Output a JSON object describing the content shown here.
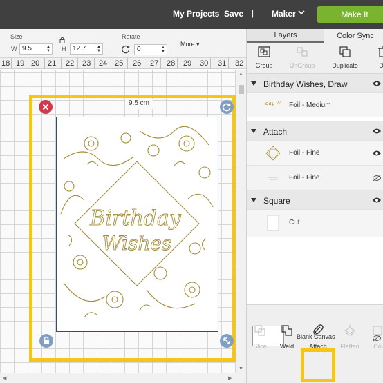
{
  "header": {
    "my_projects": "My Projects",
    "save": "Save",
    "separator": "|",
    "machine": "Maker",
    "make_it": "Make It",
    "make_it_color": "#7ab42e"
  },
  "toolbar": {
    "size_label": "Size",
    "w_label": "W",
    "w_value": "9.5",
    "h_label": "H",
    "h_value": "12.7",
    "rotate_label": "Rotate",
    "rotate_value": "0",
    "more_label": "More"
  },
  "ruler": {
    "ticks": [
      "18",
      "19",
      "20",
      "21",
      "22",
      "23",
      "24",
      "25",
      "26",
      "27",
      "28",
      "29",
      "30",
      "31",
      "32"
    ]
  },
  "canvas": {
    "width_label": "9.5 cm",
    "design_text_line1": "Birthday",
    "design_text_line2": "Wishes",
    "design_color": "#a58d36",
    "highlight_color": "#f5c518"
  },
  "panel": {
    "tabs": [
      "Layers",
      "Color Sync"
    ],
    "tools": [
      {
        "label": "Group",
        "enabled": true,
        "icon": "group-icon"
      },
      {
        "label": "UnGroup",
        "enabled": false,
        "icon": "ungroup-icon"
      },
      {
        "label": "Duplicate",
        "enabled": true,
        "icon": "duplicate-icon"
      },
      {
        "label": "De",
        "enabled": true,
        "icon": "delete-icon"
      }
    ],
    "groups": [
      {
        "name": "Birthday Wishes, Draw",
        "items": [
          {
            "label": "Foil - Medium",
            "thumb": "Birthday Wishes"
          }
        ]
      },
      {
        "name": "Attach",
        "items": [
          {
            "label": "Foil - Fine"
          },
          {
            "label": "Foil - Fine"
          }
        ]
      },
      {
        "name": "Square",
        "items": [
          {
            "label": "Cut"
          }
        ]
      }
    ],
    "blank_canvas": "Blank Canvas",
    "bottom_tools": [
      {
        "label": "Slice",
        "enabled": false,
        "icon": "slice-icon"
      },
      {
        "label": "Weld",
        "enabled": true,
        "icon": "weld-icon"
      },
      {
        "label": "Attach",
        "enabled": true,
        "icon": "attach-icon"
      },
      {
        "label": "Flatten",
        "enabled": false,
        "icon": "flatten-icon"
      },
      {
        "label": "Co",
        "enabled": false,
        "icon": "contour-icon"
      }
    ]
  }
}
